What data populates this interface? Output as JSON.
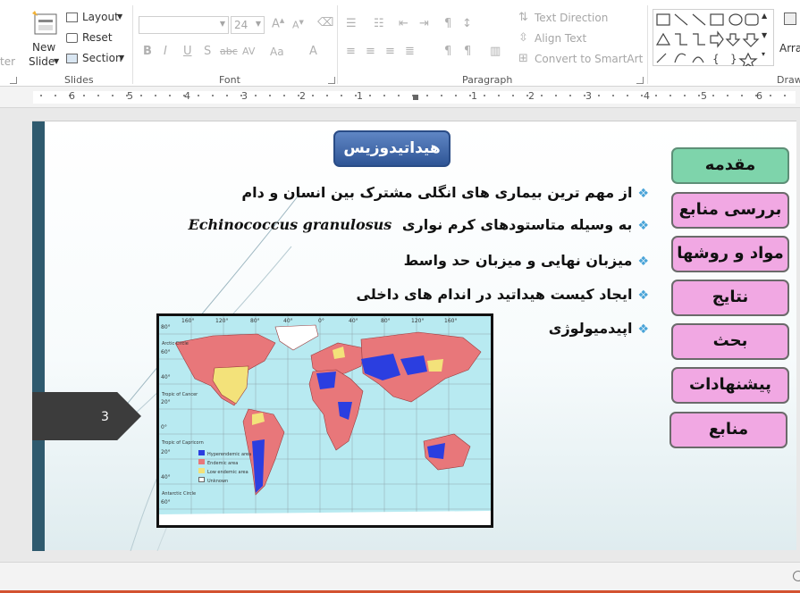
{
  "ribbon": {
    "slides_group": {
      "label": "Slides",
      "new_slide_line1": "New",
      "new_slide_line2": "Slide",
      "layout": "Layout",
      "reset": "Reset",
      "section": "Section",
      "cut_off_left": "ter"
    },
    "font_group": {
      "label": "Font",
      "font_name_value": "",
      "font_size_value": "24",
      "bold": "B",
      "italic": "I",
      "underline": "U",
      "shadow": "S",
      "strikethrough": "abc",
      "spacing": "AV",
      "change_case": "Aa",
      "font_color": "A"
    },
    "paragraph_group": {
      "label": "Paragraph",
      "text_direction": "Text Direction",
      "align_text": "Align Text",
      "convert_smartart": "Convert to SmartArt"
    },
    "drawing_group": {
      "label": "Draw",
      "arrange": "Arra"
    }
  },
  "ruler": {
    "numbers_left": [
      "6",
      "5",
      "4",
      "3",
      "2",
      "1"
    ],
    "numbers_right": [
      "1",
      "2",
      "3",
      "4",
      "5",
      "6"
    ]
  },
  "slide": {
    "title": "هیداتیدوزیس",
    "slide_number": "3",
    "bullets": [
      {
        "text": "از مهم ترین بیماری های انگلی مشترک بین انسان و دام",
        "latin": ""
      },
      {
        "text": "به وسیله متاستودهای کرم نواری",
        "latin": "Echinococcus granulosus"
      },
      {
        "text": "میزبان نهایی و میزبان حد واسط",
        "latin": ""
      },
      {
        "text": "ایجاد کیست هیداتید در اندام های داخلی",
        "latin": ""
      },
      {
        "text": "اپیدمیولوژی",
        "latin": ""
      }
    ],
    "nav_buttons": [
      "مقدمه",
      "بررسی منابع",
      "مواد و روشها",
      "نتایج",
      "بحث",
      "پیشنهادات",
      "منابع"
    ],
    "map": {
      "top_labels": [
        "160°",
        "120°",
        "80°",
        "40°",
        "0°",
        "40°",
        "80°",
        "120°",
        "160°"
      ],
      "left_labels": [
        "80°",
        "60°",
        "40°",
        "20°",
        "0°",
        "20°",
        "40°",
        "60°"
      ],
      "circles": [
        "Arctic Circle",
        "Tropic of Cancer",
        "Tropic of Capricorn",
        "Antarctic Circle"
      ],
      "legend": [
        {
          "label": "Hyperendemic area",
          "color": "#2b3ee0"
        },
        {
          "label": "Endemic area",
          "color": "#e8777a"
        },
        {
          "label": "Low endemic area",
          "color": "#f3e27a"
        },
        {
          "label": "Unknown",
          "color": "#ffffff"
        }
      ]
    }
  },
  "colors": {
    "nav_pink": "#f1a8e3",
    "nav_active": "#7ed4ab",
    "title_blue": "#2f5596",
    "accent_orange": "#d35230"
  }
}
